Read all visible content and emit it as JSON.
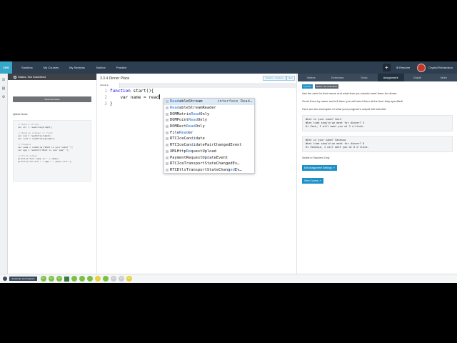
{
  "nav": {
    "logo_text": "CHS",
    "links": [
      "Sandbox",
      "My Courses",
      "My Sections",
      "Toolbox",
      "Practice"
    ],
    "plus": "+",
    "resume": "Resume",
    "user_name": "Crystal Richardson"
  },
  "left": {
    "status": "Status: Not Submitted",
    "show_exercises": "Show Exercises",
    "quick_docs_title": "Quick Docs",
    "quick_docs_code": [
      {
        "text": "// Read a string",
        "comment": true
      },
      {
        "text": "var str = readLine(prompt);",
        "comment": false
      },
      {
        "text": "",
        "comment": false
      },
      {
        "text": "// Read an integer or float",
        "comment": true
      },
      {
        "text": "var num = readInt(prompt);",
        "comment": false
      },
      {
        "text": "var cost = readFloat(prompt);",
        "comment": false
      },
      {
        "text": "",
        "comment": false
      },
      {
        "text": "// Example",
        "comment": true
      },
      {
        "text": "var name = readLine(\"What is your name? \");",
        "comment": false
      },
      {
        "text": "var age = readInt(\"What is your age? \");",
        "comment": false
      },
      {
        "text": "",
        "comment": false
      },
      {
        "text": "// Print output",
        "comment": true
      },
      {
        "text": "println(\"Your name is \" + name);",
        "comment": false
      },
      {
        "text": "println(\"You are \" + age + \" years old.\");",
        "comment": false
      }
    ]
  },
  "editor": {
    "title": "3.3.4 Dinner Plans",
    "submit_label": "Submit + Continue",
    "new_label": "New",
    "file_tab": "default.js",
    "lines": [
      {
        "num": "1",
        "kw": "function",
        "text": " start(){"
      },
      {
        "num": "2",
        "kw": "",
        "text": "    var name = read"
      },
      {
        "num": "3",
        "kw": "",
        "text": "}"
      }
    ],
    "autocomplete": [
      {
        "hl": "Read",
        "rest": "ableStream",
        "type": "interface Read…",
        "selected": true
      },
      {
        "hl": "Read",
        "rest": "ableStreamReader",
        "type": "",
        "selected": false
      },
      {
        "pre": "DOMMatrix",
        "hl": "Read",
        "rest": "Only",
        "type": "",
        "selected": false
      },
      {
        "pre": "DOMPoint",
        "hl": "Read",
        "rest": "Only",
        "type": "",
        "selected": false
      },
      {
        "pre": "DOMRect",
        "hl": "Read",
        "rest": "Only",
        "type": "",
        "selected": false
      },
      {
        "pre": "File",
        "hl": "Read",
        "rest": "er",
        "type": "",
        "selected": false
      },
      {
        "pre": "RTCIceCan",
        "hl": "d",
        "rest": "idate",
        "type": "",
        "selected": false
      },
      {
        "pre": "RTCIceCan",
        "hl": "d",
        "rest": "idatePairChangedEvent",
        "type": "",
        "selected": false
      },
      {
        "pre": "XMLHttp",
        "hl": "Re",
        "rest": "questUpload",
        "type": "",
        "selected": false
      },
      {
        "pre": "PaymentRequestUp",
        "hl": "d",
        "rest": "ateEvent",
        "type": "",
        "selected": false
      },
      {
        "pre": "RTCIceTransportStateChangedEv",
        "hl": "",
        "rest": "…",
        "type": "",
        "selected": false
      },
      {
        "pre": "RTCDtlsTransportStateChang",
        "hl": "ed",
        "rest": "Ev…",
        "type": "",
        "selected": false
      }
    ]
  },
  "right": {
    "tabs": [
      "Videos",
      "Exercises",
      "Docs",
      "Assignment",
      "Grade",
      "More"
    ],
    "active_tab": 3,
    "badge_points": "5 points",
    "badge_status": "Status: Not Submitted",
    "p1": "Ask the user for their name and what time you should meet them for dinner.",
    "p2": "Greet them by name and tell them you will meet them at the time they specified!",
    "p3": "Here are two examples of what your program's output will look like:",
    "example1": [
      "What is your name? Zach",
      "What time should we meet for dinner? 3",
      "Hi Zach, I will meet you at 3 o'clock."
    ],
    "example2": [
      "What is your name? Vanessa",
      "What time should we meet for dinner? 6",
      "Hi Vanessa, I will meet you at 6 o'clock."
    ],
    "teachers_only": "Visible to Teachers Only",
    "btn_settings": "Edit Assignment Settings",
    "btn_course": "View Course"
  },
  "bottom": {
    "course": "JavaScript and Graphics",
    "dots": [
      {
        "label": "3.1",
        "color": "#79c044"
      },
      {
        "label": "3.2",
        "color": "#79c044"
      },
      {
        "label": "3.3",
        "color": "#79c044"
      },
      {
        "label": "",
        "color": "#3a7a45",
        "square": true
      },
      {
        "label": "",
        "color": "#79c044"
      },
      {
        "label": "",
        "color": "#79c044"
      },
      {
        "label": "",
        "color": "#79c044"
      },
      {
        "label": "",
        "color": "#e6d23c"
      },
      {
        "label": "",
        "color": "#79c044"
      },
      {
        "label": "3.4",
        "color": "#c9ccd0"
      },
      {
        "label": "3.5",
        "color": "#c9ccd0"
      },
      {
        "label": "3.6",
        "color": "#e6d23c"
      }
    ]
  }
}
